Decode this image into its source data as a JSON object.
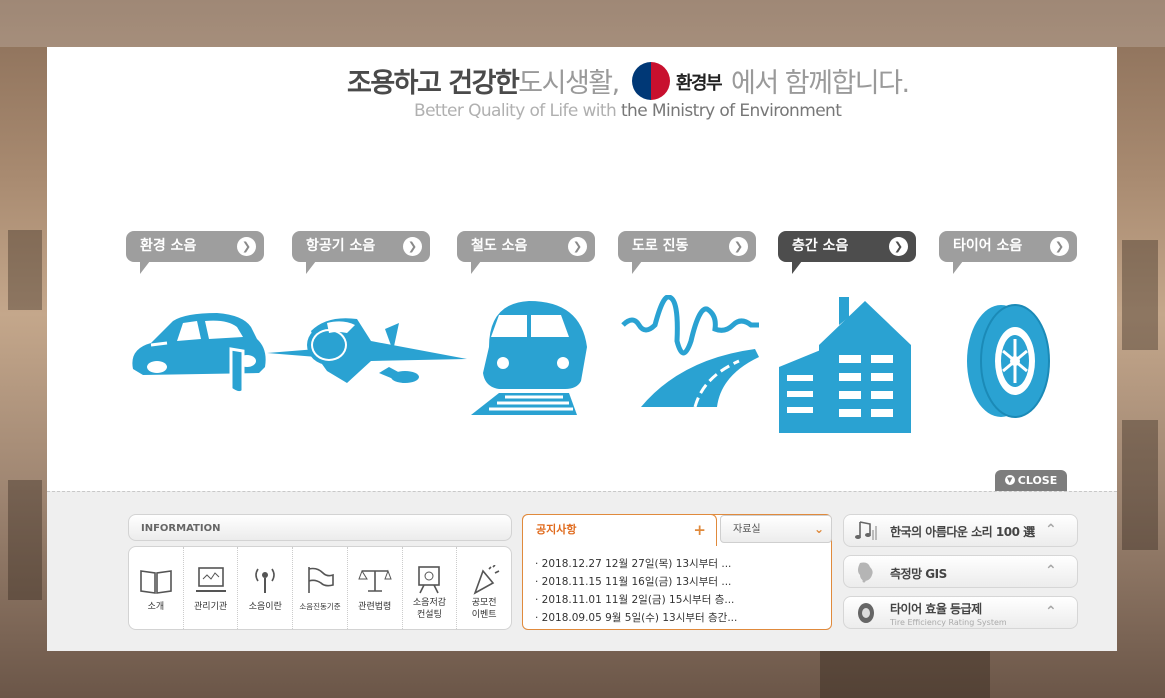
{
  "headline": {
    "part1": "조용하고 건강한",
    "part2": "도시생활,",
    "ministry": "환경부",
    "part3": "에서  함께합니다.",
    "sub1": "Better Quality of Life",
    "sub2": "with",
    "sub3": "the Ministry of Environment"
  },
  "categories": [
    {
      "label": "환경 소음",
      "active": false
    },
    {
      "label": "항공기 소음",
      "active": false
    },
    {
      "label": "철도 소음",
      "active": false
    },
    {
      "label": "도로 진동",
      "active": false
    },
    {
      "label": "층간 소음",
      "active": true
    },
    {
      "label": "타이어 소음",
      "active": false
    }
  ],
  "colors": {
    "accent_blue": "#2aa2d2",
    "notice_orange": "#e08a3c",
    "category_gray": "#9e9e9e",
    "category_active": "#4d4d4d"
  },
  "close_label": "CLOSE",
  "information": {
    "title": "INFORMATION",
    "items": [
      {
        "label": "소개",
        "icon": "book-icon"
      },
      {
        "label": "관리기관",
        "icon": "monitor-icon"
      },
      {
        "label": "소음이란",
        "icon": "antenna-icon"
      },
      {
        "label": "소음진동기준",
        "icon": "flag-icon"
      },
      {
        "label": "관련법령",
        "icon": "scales-icon"
      },
      {
        "label": "소음저감\n컨설팅",
        "icon": "easel-icon"
      },
      {
        "label": "공모전\n이벤트",
        "icon": "party-popper-icon"
      }
    ]
  },
  "notice": {
    "tab_label": "공지사항",
    "data_tab_label": "자료실",
    "items": [
      "· 2018.12.27 12월 27일(목) 13시부터 ...",
      "· 2018.11.15 11월 16일(금) 13시부터 ...",
      "· 2018.11.01 11월 2일(금) 15시부터 층...",
      "· 2018.09.05 9월 5일(수) 13시부터 층간..."
    ]
  },
  "links": [
    {
      "label": "한국의 아름다운 소리 100 選",
      "icon": "music-note-icon",
      "sub": ""
    },
    {
      "label": "측정망 GIS",
      "icon": "korea-map-icon",
      "sub": ""
    },
    {
      "label": "타이어 효율 등급제",
      "icon": "tire-icon",
      "sub": "Tire Efficiency Rating System"
    }
  ]
}
